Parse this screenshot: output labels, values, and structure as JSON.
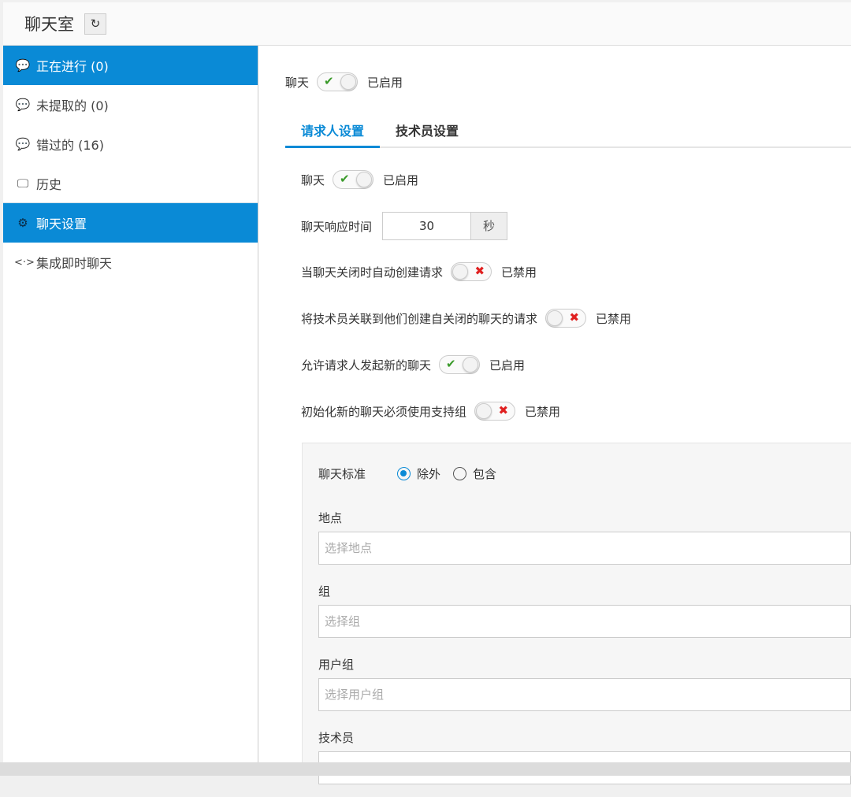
{
  "header": {
    "title": "聊天室",
    "refresh_icon": "refresh-icon"
  },
  "sidebar": {
    "items": [
      {
        "label": "正在进行 (0)",
        "icon": "chat-icon",
        "active": true
      },
      {
        "label": "未提取的 (0)",
        "icon": "chat-icon",
        "active": false
      },
      {
        "label": "错过的 (16)",
        "icon": "chat-alert-icon",
        "active": false
      },
      {
        "label": "历史",
        "icon": "monitor-icon",
        "active": false
      },
      {
        "label": "聊天设置",
        "icon": "gear-icon",
        "active": true
      },
      {
        "label": "集成即时聊天",
        "icon": "code-icon",
        "active": false
      }
    ]
  },
  "main": {
    "chat_toggle": {
      "label": "聊天",
      "state": "已启用"
    },
    "tabs": [
      {
        "label": "请求人设置",
        "active": true
      },
      {
        "label": "技术员设置",
        "active": false
      }
    ],
    "settings": [
      {
        "label": "聊天",
        "state": "已启用",
        "on": true
      },
      {
        "label": "聊天响应时间",
        "value": "30",
        "unit": "秒"
      },
      {
        "label": "当聊天关闭时自动创建请求",
        "state": "已禁用",
        "on": false
      },
      {
        "label": "将技术员关联到他们创建自关闭的聊天的请求",
        "state": "已禁用",
        "on": false
      },
      {
        "label": "允许请求人发起新的聊天",
        "state": "已启用",
        "on": true
      },
      {
        "label": "初始化新的聊天必须使用支持组",
        "state": "已禁用",
        "on": false
      }
    ],
    "criteria": {
      "label": "聊天标准",
      "options": [
        "除外",
        "包含"
      ],
      "selected": "除外"
    },
    "fields": [
      {
        "label": "地点",
        "placeholder": "选择地点"
      },
      {
        "label": "组",
        "placeholder": "选择组"
      },
      {
        "label": "用户组",
        "placeholder": "选择用户组"
      },
      {
        "label": "技术员",
        "placeholder": ""
      }
    ]
  },
  "colors": {
    "accent": "#0a8ad6",
    "on": "#3a9a2a",
    "off": "#e02020"
  }
}
